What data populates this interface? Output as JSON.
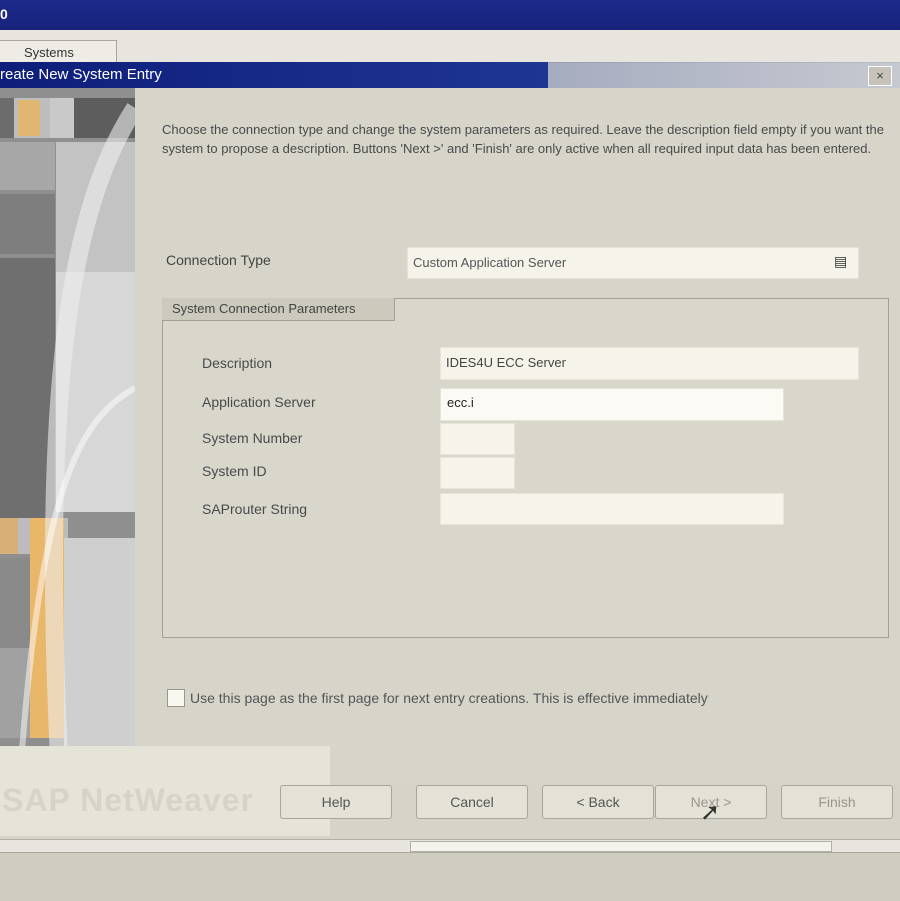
{
  "window": {
    "outer_title": "0",
    "tab_label": "Systems",
    "dialog_title": "reate New System Entry",
    "close_glyph": "×"
  },
  "intro_text": "Choose the connection type and change the system parameters as required. Leave the description field empty if you want the system to propose a description. Buttons 'Next >' and 'Finish' are only active when all required input data has been entered.",
  "connection": {
    "label": "Connection Type",
    "value": "Custom Application Server",
    "icon": "dropdown-list-icon",
    "icon_glyph": "▤"
  },
  "group": {
    "title": "System Connection Parameters",
    "fields": {
      "description_label": "Description",
      "description_value": "IDES4U ECC Server",
      "app_server_label": "Application Server",
      "app_server_value": "ecc.i",
      "system_number_label": "System Number",
      "system_number_value": "",
      "system_id_label": "System ID",
      "system_id_value": "",
      "saprouter_label": "SAProuter String",
      "saprouter_value": ""
    }
  },
  "checkbox": {
    "label": "Use this page as the first page for next entry creations. This is effective immediately",
    "checked": false
  },
  "brand_text": "SAP NetWeaver",
  "buttons": {
    "help": "Help",
    "cancel": "Cancel",
    "back": "< Back",
    "next": "Next >",
    "finish": "Finish"
  },
  "cursor_glyph": "➚",
  "colors": {
    "title_bar": "#17237a",
    "dialog_bg": "#d7d4ca",
    "field_bg": "#f6f4ea",
    "accent_orange": "#e9b76a"
  }
}
